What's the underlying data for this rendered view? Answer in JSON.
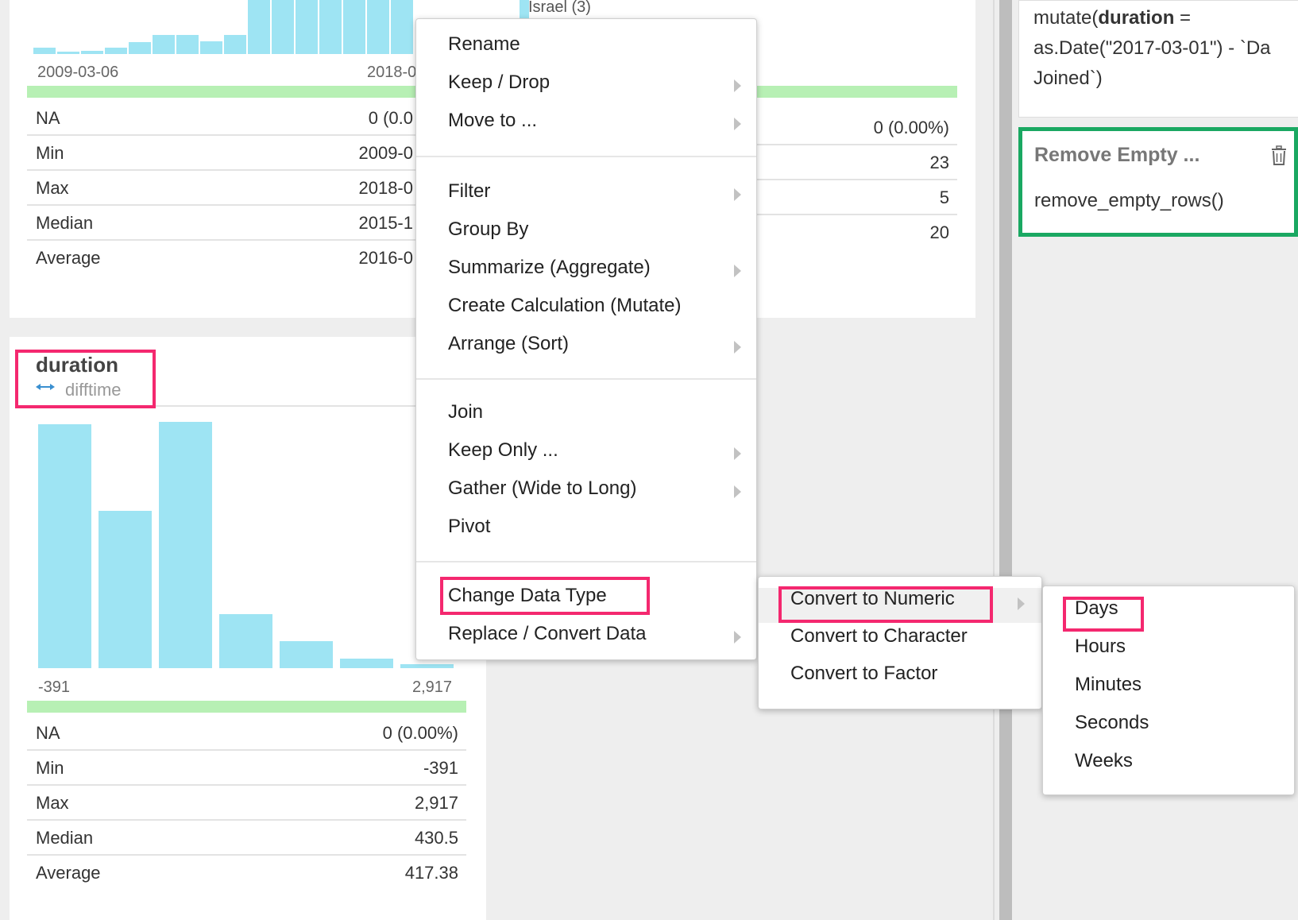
{
  "top_column": {
    "x_min_label": "2009-03-06",
    "x_max_label": "2018-0",
    "stats": [
      {
        "label": "NA",
        "value": "0 (0.0"
      },
      {
        "label": "Min",
        "value": "2009-0"
      },
      {
        "label": "Max",
        "value": "2018-0"
      },
      {
        "label": "Median",
        "value": "2015-1"
      },
      {
        "label": "Average",
        "value": "2016-0"
      }
    ]
  },
  "middle_column": {
    "category_label": "Israel (3)",
    "stats": [
      "0 (0.00%)",
      "23",
      "5",
      "20"
    ]
  },
  "duration_column": {
    "name": "duration",
    "type": "difftime",
    "type_icon": "double-arrow-icon",
    "x_min_label": "-391",
    "x_max_label": "2,917",
    "histogram_levels": [
      0.99,
      0.64,
      1.0,
      0.22,
      0.11,
      0.04,
      0.015
    ],
    "stats": [
      {
        "label": "NA",
        "value": "0 (0.00%)"
      },
      {
        "label": "Min",
        "value": "-391"
      },
      {
        "label": "Max",
        "value": "2,917"
      },
      {
        "label": "Median",
        "value": "430.5"
      },
      {
        "label": "Average",
        "value": "417.38"
      }
    ]
  },
  "context_menu": {
    "group1": [
      "Rename",
      "Keep / Drop",
      "Move to ..."
    ],
    "group2": [
      "Filter",
      "Group By",
      "Summarize (Aggregate)",
      "Create Calculation (Mutate)",
      "Arrange (Sort)"
    ],
    "group3": [
      "Join",
      "Keep Only ...",
      "Gather (Wide to Long)",
      "Pivot"
    ],
    "group4": [
      "Change Data Type",
      "Replace / Convert Data"
    ]
  },
  "submenu": [
    "Convert to Numeric",
    "Convert to Character",
    "Convert to Factor"
  ],
  "units_menu": [
    "Days",
    "Hours",
    "Minutes",
    "Seconds",
    "Weeks"
  ],
  "steps": {
    "mutate_code_l1_pre": "mutate(",
    "mutate_code_l1_bold": "duration",
    "mutate_code_l1_post": " =",
    "mutate_code_l2": "as.Date(\"2017-03-01\") - `Da",
    "mutate_code_l3": "Joined`)",
    "remove_title": "Remove Empty ...",
    "remove_code": "remove_empty_rows()",
    "trash_icon": "trash-icon"
  },
  "colors": {
    "highlight": "#f4286f",
    "bar": "#9ee4f3",
    "green": "#b7f0b4",
    "step_border": "#1aa862"
  }
}
